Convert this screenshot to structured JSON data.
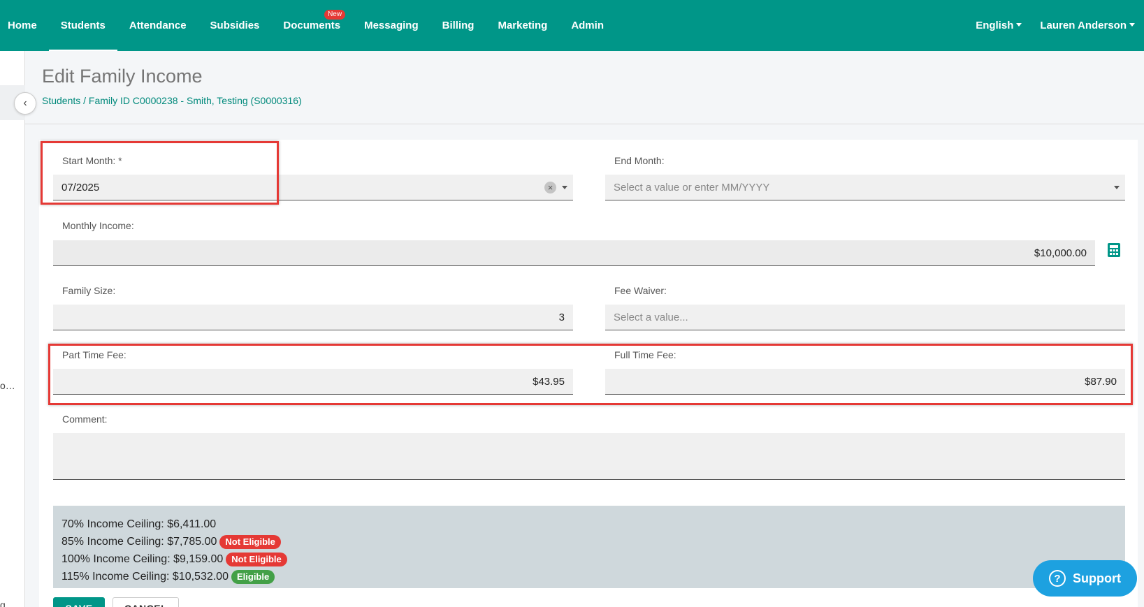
{
  "nav": {
    "items": [
      "Home",
      "Students",
      "Attendance",
      "Subsidies",
      "Documents",
      "Messaging",
      "Billing",
      "Marketing",
      "Admin"
    ],
    "active": "Students",
    "new_badge": "New",
    "language": "English",
    "user": "Lauren Anderson"
  },
  "leftrail": {
    "text1": "o…",
    "text2": "g…"
  },
  "page": {
    "title": "Edit Family Income",
    "breadcrumb": "Students / Family ID C0000238 - Smith, Testing (S0000316)"
  },
  "form": {
    "start_month": {
      "label": "Start Month: *",
      "value": "07/2025"
    },
    "end_month": {
      "label": "End Month:",
      "placeholder": "Select a value or enter MM/YYYY"
    },
    "monthly_income": {
      "label": "Monthly Income:",
      "value": "$10,000.00"
    },
    "family_size": {
      "label": "Family Size:",
      "value": "3"
    },
    "fee_waiver": {
      "label": "Fee Waiver:",
      "placeholder": "Select a value..."
    },
    "part_time_fee": {
      "label": "Part Time Fee:",
      "value": "$43.95"
    },
    "full_time_fee": {
      "label": "Full Time Fee:",
      "value": "$87.90"
    },
    "comment": {
      "label": "Comment:",
      "value": ""
    }
  },
  "ceilings": [
    {
      "text": "70% Income Ceiling: $6,411.00",
      "badge": ""
    },
    {
      "text": "85% Income Ceiling: $7,785.00",
      "badge": "Not Eligible"
    },
    {
      "text": "100% Income Ceiling: $9,159.00",
      "badge": "Not Eligible"
    },
    {
      "text": "115% Income Ceiling: $10,532.00",
      "badge": "Eligible"
    }
  ],
  "buttons": {
    "save": "SAVE",
    "cancel": "CANCEL"
  },
  "support": {
    "label": "Support"
  },
  "colors": {
    "primary": "#009688",
    "highlight": "#e53935",
    "eligible": "#43a047",
    "not_eligible": "#e53935",
    "support": "#1da1e0"
  },
  "icons": [
    "chevron-left-icon",
    "clear-icon",
    "dropdown-caret-icon",
    "calculator-icon",
    "question-icon"
  ]
}
